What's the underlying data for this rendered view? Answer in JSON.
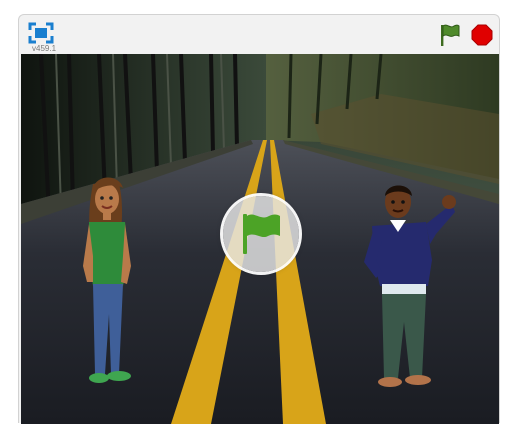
{
  "player": {
    "version": "v459.1",
    "fullscreen_icon": "fullscreen-icon",
    "go_icon": "green-flag-icon",
    "stop_icon": "stop-sign-icon",
    "accent_green": "#4ca326",
    "stop_red": "#e00000"
  },
  "stage": {
    "backdrop": "forest-road",
    "overlay_icon": "green-flag-icon",
    "sprites": [
      "girl-character",
      "boy-character-waving"
    ]
  }
}
